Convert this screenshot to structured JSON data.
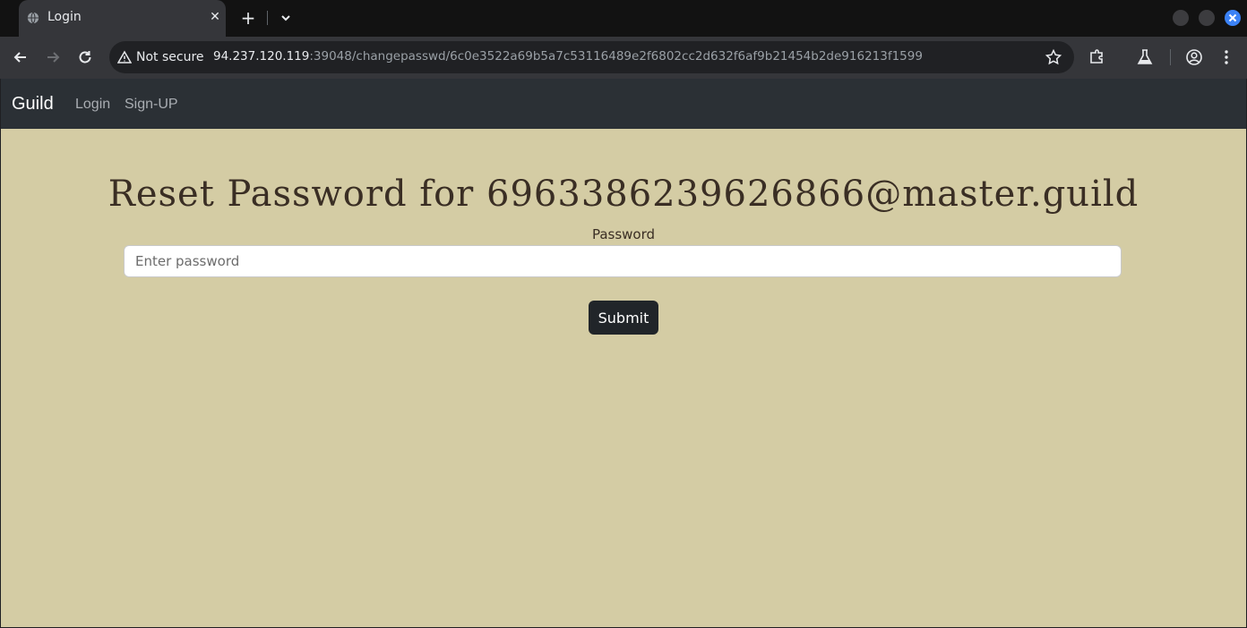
{
  "browser": {
    "tab": {
      "title": "Login",
      "favicon": "globe-icon"
    },
    "address": {
      "security_label": "Not secure",
      "host": "94.237.120.119",
      "path": ":39048/changepasswd/6c0e3522a69b5a7c53116489e2f6802cc2d632f6af9b21454b2de916213f1599"
    },
    "accent_close": "#3b82f6"
  },
  "page": {
    "navbar": {
      "brand": "Guild",
      "links": [
        "Login",
        "Sign-UP"
      ]
    },
    "heading": "Reset Password for 69633862396268​66@master.guild",
    "form": {
      "label": "Password",
      "placeholder": "Enter password",
      "submit_label": "Submit"
    },
    "colors": {
      "background": "#d4cca4",
      "navbar": "#2b3035",
      "button": "#212529",
      "text": "#3a2e24"
    }
  }
}
